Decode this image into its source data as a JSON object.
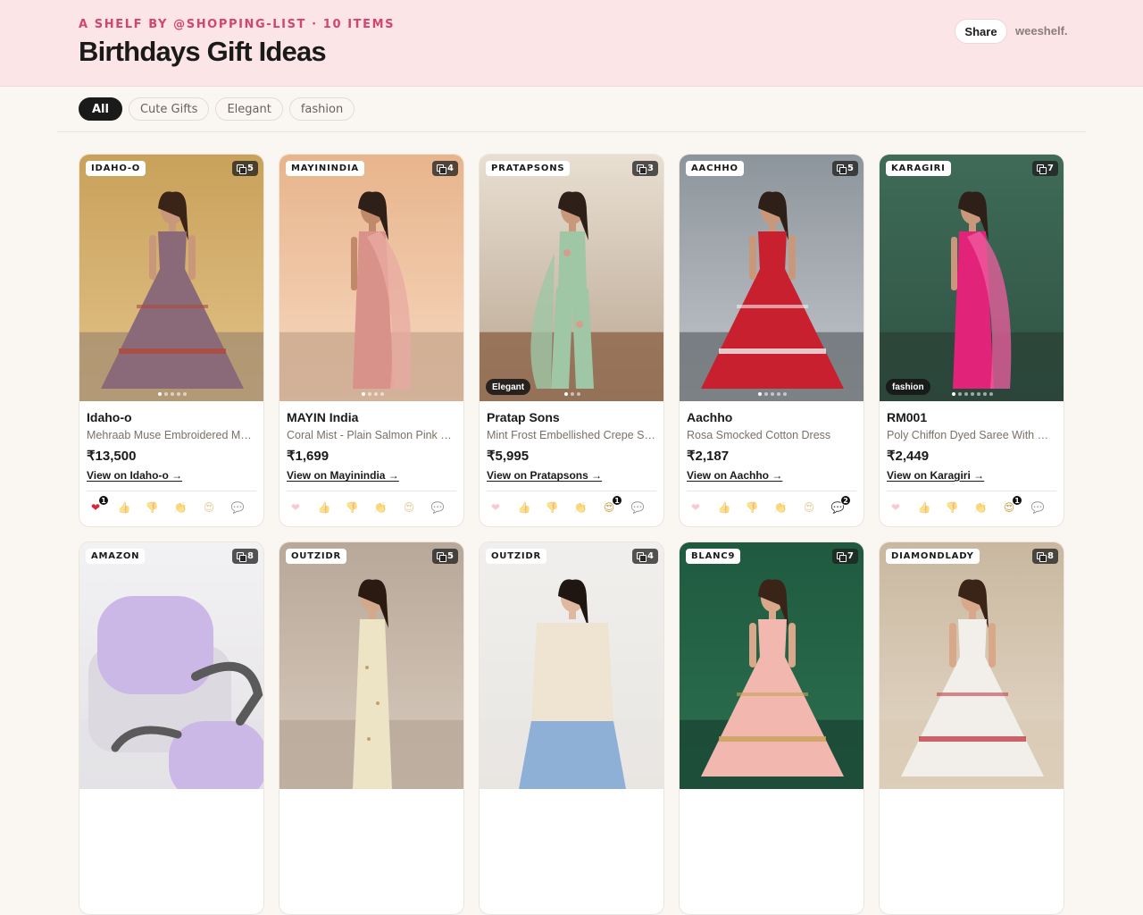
{
  "header": {
    "eyebrow": "A SHELF BY @SHOPPING-LIST · 10 ITEMS",
    "title": "Birthdays Gift Ideas",
    "share_label": "Share",
    "brand": "weeshelf."
  },
  "filters": [
    {
      "label": "All",
      "active": true
    },
    {
      "label": "Cute Gifts",
      "active": false
    },
    {
      "label": "Elegant",
      "active": false
    },
    {
      "label": "fashion",
      "active": false
    }
  ],
  "reaction_icons": [
    "heart-icon",
    "thumbs-up-icon",
    "thumbs-down-icon",
    "clap-icon",
    "heart-eyes-icon",
    "comment-icon"
  ],
  "cards": [
    {
      "store_badge": "IDAHO-O",
      "image_count": "5",
      "tag": "",
      "store_name": "Idaho-o",
      "product": "Mehraab Muse Embroidered Maroon Lehenga",
      "price": "₹13,500",
      "link": "View on Idaho-o →",
      "dots": 5,
      "active_dot": 0,
      "reactions": {
        "heart-icon": "1"
      }
    },
    {
      "store_badge": "MAYININDIA",
      "image_count": "4",
      "tag": "",
      "store_name": "MAYIN India",
      "product": "Coral Mist - Plain Salmon Pink Saree",
      "price": "₹1,699",
      "link": "View on Mayinindia →",
      "dots": 4,
      "active_dot": 0,
      "reactions": {}
    },
    {
      "store_badge": "PRATAPSONS",
      "image_count": "3",
      "tag": "Elegant",
      "store_name": "Pratap Sons",
      "product": "Mint Frost Embellished Crepe Silk Co-ord",
      "price": "₹5,995",
      "link": "View on Pratapsons →",
      "dots": 3,
      "active_dot": 0,
      "reactions": {
        "heart-eyes-icon": "1"
      }
    },
    {
      "store_badge": "AACHHO",
      "image_count": "5",
      "tag": "",
      "store_name": "Aachho",
      "product": "Rosa Smocked Cotton Dress",
      "price": "₹2,187",
      "link": "View on Aachho →",
      "dots": 5,
      "active_dot": 0,
      "reactions": {
        "comment-icon": "2"
      }
    },
    {
      "store_badge": "KARAGIRI",
      "image_count": "7",
      "tag": "fashion",
      "store_name": "RM001",
      "product": "Poly Chiffon Dyed Saree With Hand Work",
      "price": "₹2,449",
      "link": "View on Karagiri →",
      "dots": 7,
      "active_dot": 0,
      "reactions": {
        "heart-eyes-icon": "1"
      }
    },
    {
      "store_badge": "AMAZON",
      "image_count": "8",
      "tag": "",
      "store_name": "",
      "product": "",
      "price": "",
      "link": "",
      "dots": 0,
      "active_dot": 0,
      "reactions": {}
    },
    {
      "store_badge": "OUTZIDR",
      "image_count": "5",
      "tag": "",
      "store_name": "",
      "product": "",
      "price": "",
      "link": "",
      "dots": 0,
      "active_dot": 0,
      "reactions": {}
    },
    {
      "store_badge": "OUTZIDR",
      "image_count": "4",
      "tag": "",
      "store_name": "",
      "product": "",
      "price": "",
      "link": "",
      "dots": 0,
      "active_dot": 0,
      "reactions": {}
    },
    {
      "store_badge": "BLANC9",
      "image_count": "7",
      "tag": "",
      "store_name": "",
      "product": "",
      "price": "",
      "link": "",
      "dots": 0,
      "active_dot": 0,
      "reactions": {}
    },
    {
      "store_badge": "DIAMONDLADY",
      "image_count": "8",
      "tag": "",
      "store_name": "",
      "product": "",
      "price": "",
      "link": "",
      "dots": 0,
      "active_dot": 0,
      "reactions": {}
    }
  ],
  "colors": {
    "header_bg": "#fbe5e7",
    "accent": "#d4456a",
    "page_bg": "#faf7f2"
  }
}
